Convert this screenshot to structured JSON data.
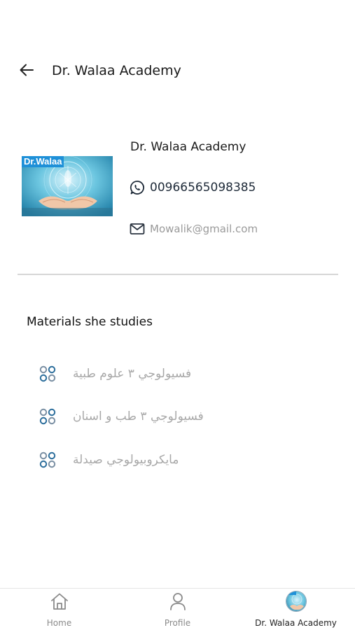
{
  "app_bar": {
    "title": "Dr. Walaa Academy",
    "back_icon": "arrow-left-icon"
  },
  "profile": {
    "name": "Dr. Walaa Academy",
    "thumbnail_brand": "Dr.Walaa",
    "phone": "00966565098385",
    "phone_icon": "whatsapp-icon",
    "email": "Mowalik@gmail.com",
    "email_icon": "mail-icon"
  },
  "materials": {
    "title": "Materials she studies",
    "icon": "grid-circles-icon",
    "items": [
      {
        "label": "فسيولوجي ٣ علوم طبية"
      },
      {
        "label": "فسيولوجي ٣ طب و اسنان"
      },
      {
        "label": "مايكروبيولوجي صيدلة"
      }
    ]
  },
  "bottom_nav": {
    "items": [
      {
        "label": "Home",
        "icon": "home-icon"
      },
      {
        "label": "Profile",
        "icon": "person-icon"
      },
      {
        "label": "Dr. Walaa Academy",
        "icon": "avatar-image",
        "active": true
      }
    ]
  },
  "colors": {
    "accent_blue": "#2c6e9c",
    "text_dark": "#1a1a1a",
    "text_muted": "#a8a8a8",
    "divider": "#d6d6d6",
    "brand_badge": "#1e90d8"
  }
}
